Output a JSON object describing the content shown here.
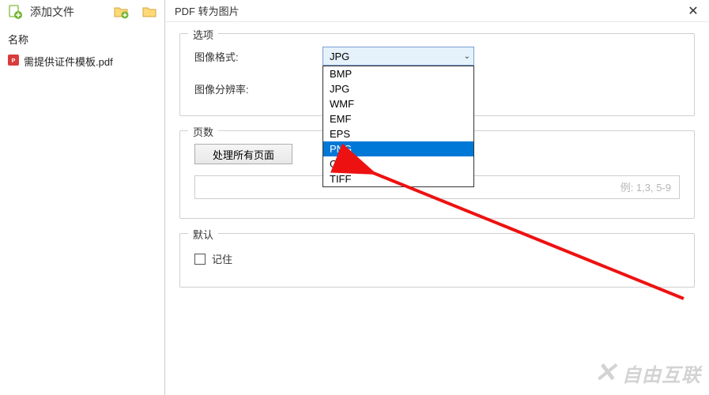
{
  "toolbar": {
    "add_file_label": "添加文件"
  },
  "left": {
    "col_name": "名称",
    "file_name": "需提供证件模板.pdf"
  },
  "dialog": {
    "title": "PDF 转为图片",
    "groups": {
      "options_legend": "选项",
      "format_label": "图像格式:",
      "resolution_label": "图像分辨率:",
      "pages_legend": "页数",
      "process_all_btn": "处理所有页面",
      "pages_placeholder": "例: 1,3, 5-9",
      "default_legend": "默认",
      "remember_label": "记住"
    },
    "combo": {
      "selected": "JPG",
      "options": [
        "BMP",
        "JPG",
        "WMF",
        "EMF",
        "EPS",
        "PNG",
        "GIF",
        "TIFF"
      ],
      "highlighted": "PNG"
    }
  },
  "watermark": {
    "text": "自由互联"
  }
}
